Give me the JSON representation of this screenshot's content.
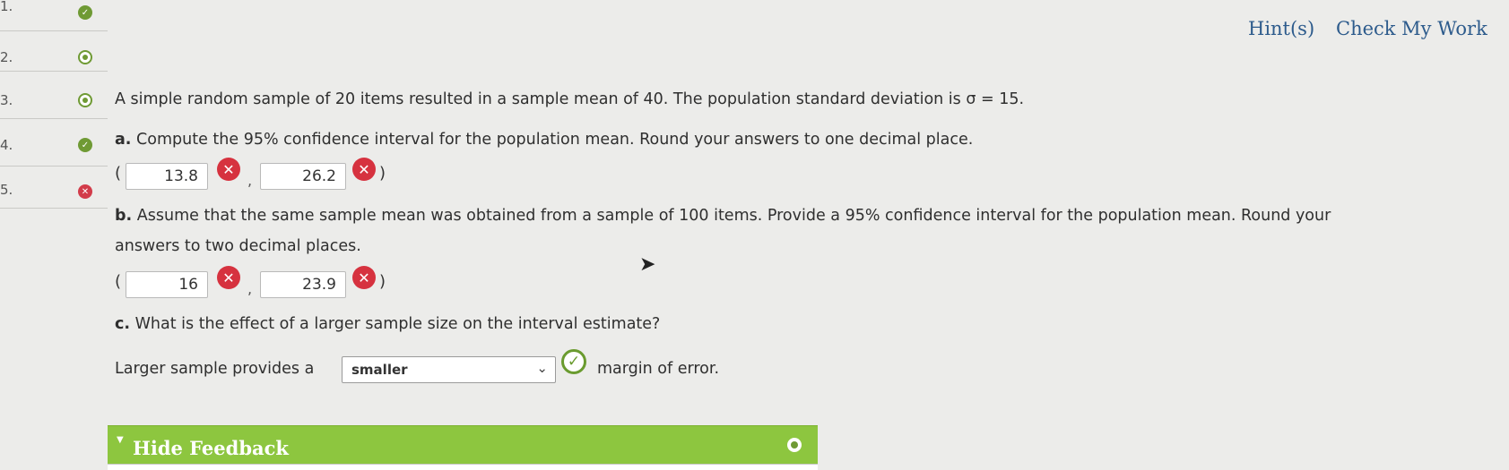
{
  "nav": {
    "questions": [
      {
        "num": "1.",
        "status": "correct"
      },
      {
        "num": "2.",
        "status": "partial"
      },
      {
        "num": "3.",
        "status": "partial"
      },
      {
        "num": "4.",
        "status": "correct"
      },
      {
        "num": "5.",
        "status": "incorrect"
      }
    ]
  },
  "header": {
    "hints_label": "Hint(s)",
    "check_label": "Check My Work"
  },
  "problem": {
    "intro": "A simple random sample of 20 items resulted in a sample mean of 40. The population standard deviation is σ = 15.",
    "part_a": {
      "label": "a.",
      "text": "Compute the 95% confidence interval for the population mean. Round your answers to one decimal place.",
      "lower": "13.8",
      "upper": "26.2"
    },
    "part_b": {
      "label": "b.",
      "text_line1": "Assume that the same sample mean was obtained from a sample of 100 items. Provide a 95% confidence interval for the population mean. Round your",
      "text_line2": "answers to two decimal places.",
      "lower": "16",
      "upper": "23.9"
    },
    "part_c": {
      "label": "c.",
      "text": "What is the effect of a larger sample size on the interval estimate?",
      "sentence_before": "Larger sample provides a",
      "selected": "smaller",
      "sentence_after": "margin of error."
    }
  },
  "punct": {
    "open": "(",
    "close": ")",
    "comma": ","
  },
  "feedback": {
    "title": "Hide Feedback"
  },
  "colors": {
    "correct": "#6f9a34",
    "incorrect": "#d6323f",
    "link": "#2d5b8c",
    "feedback_bar": "#8dc63f"
  }
}
